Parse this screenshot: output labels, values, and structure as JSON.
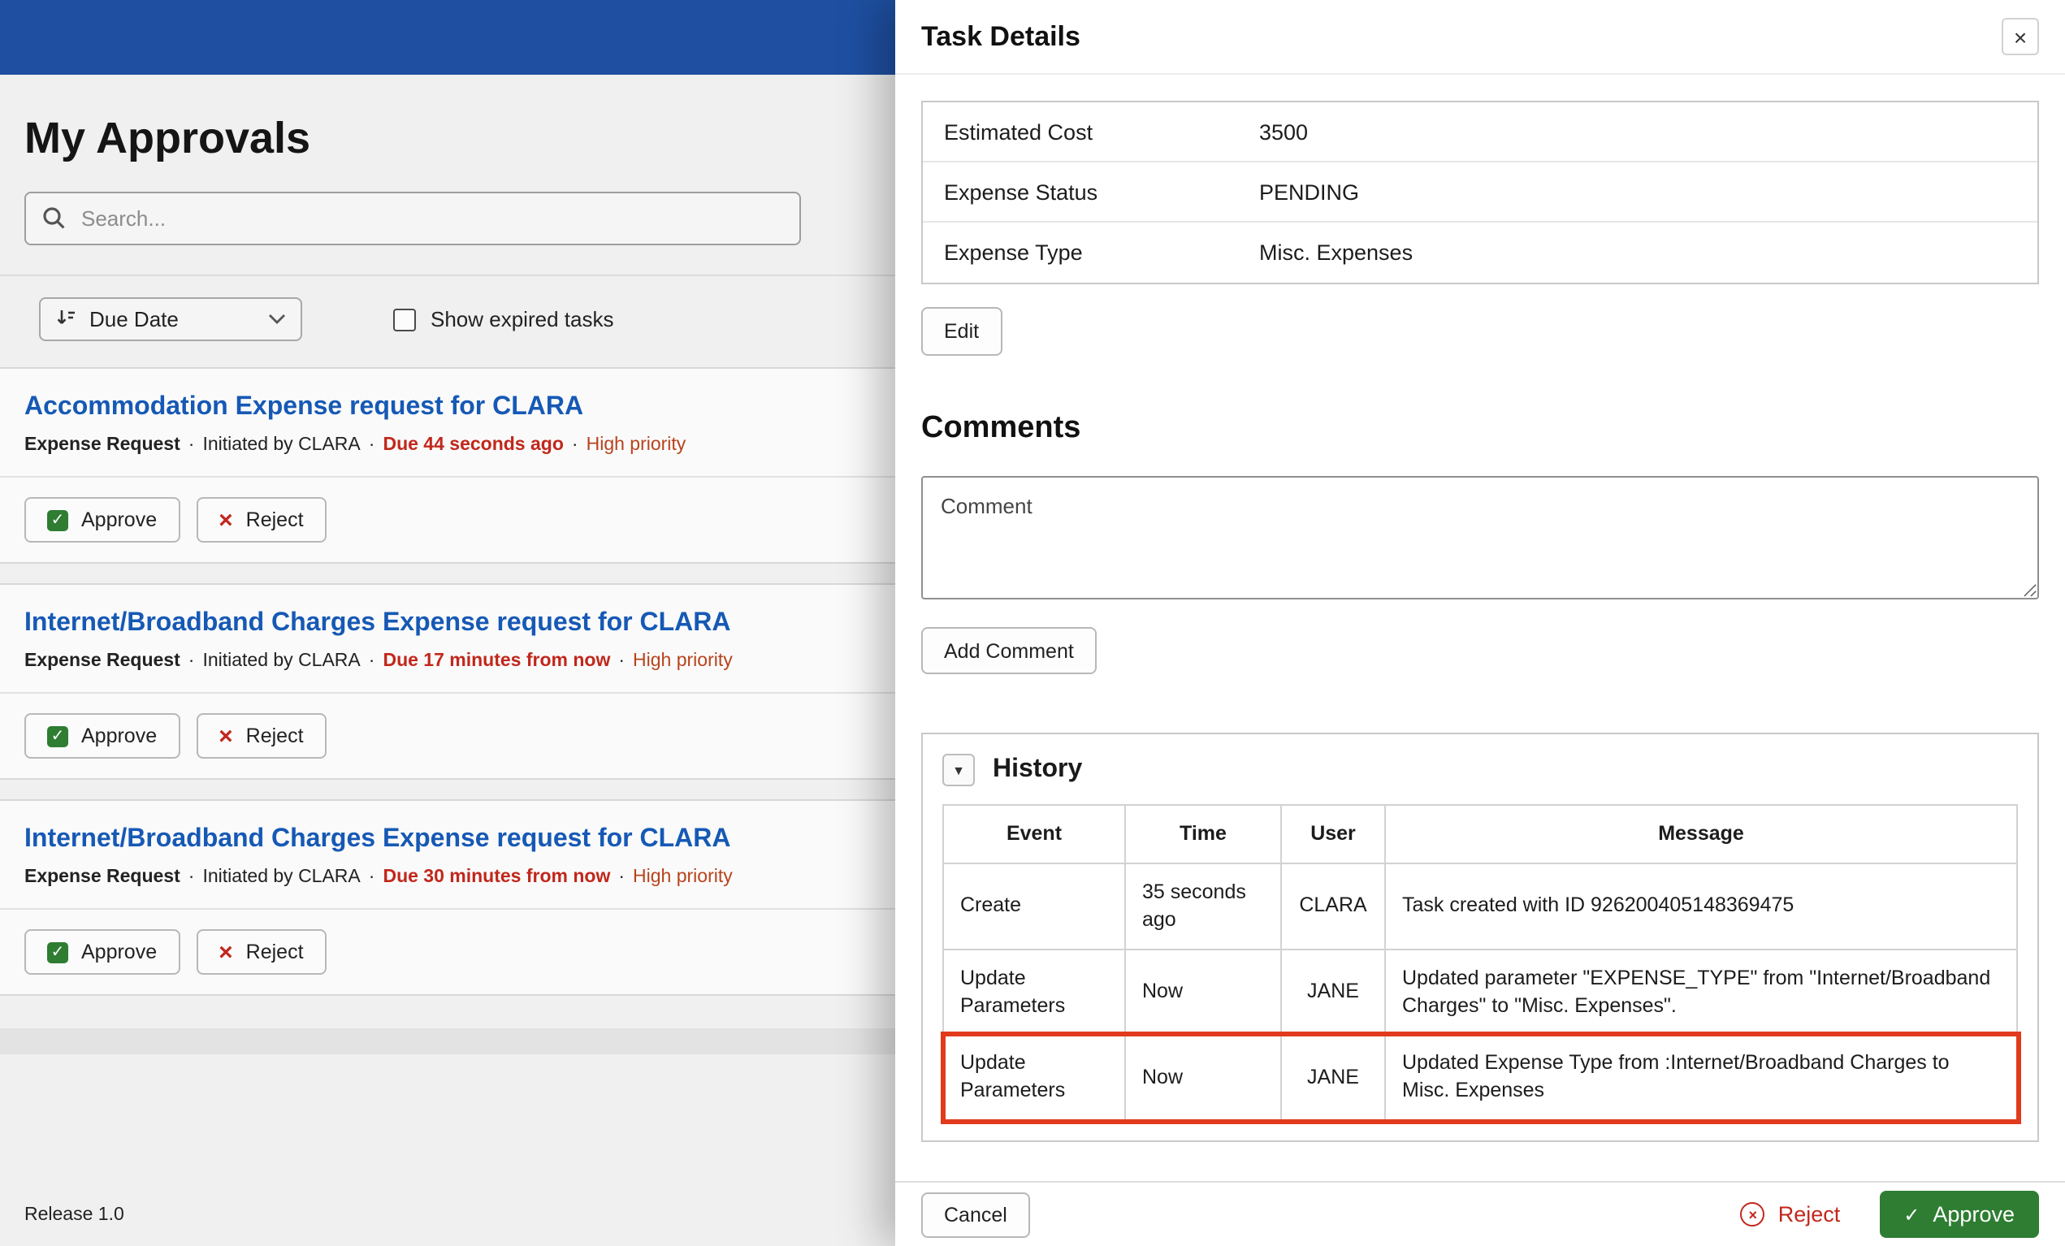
{
  "ui": {
    "dot": "·"
  },
  "icons": {
    "close": "×",
    "check": "✓",
    "cross": "×",
    "collapse": "▼"
  },
  "colors": {
    "header_blue": "#1e4fa1",
    "link_blue": "#1659b5",
    "approve_green": "#2e7d32",
    "danger_red": "#c3271d",
    "highlight_red": "#e23a1d"
  },
  "page": {
    "title": "My Approvals",
    "release": "Release 1.0"
  },
  "search": {
    "placeholder": "Search..."
  },
  "toolbar": {
    "sort_label": "Due Date",
    "show_expired_label": "Show expired tasks"
  },
  "actions": {
    "approve": "Approve",
    "reject": "Reject"
  },
  "tasks": [
    {
      "title": "Accommodation Expense request for CLARA",
      "type": "Expense Request",
      "initiated": "Initiated by CLARA",
      "due": "Due 44 seconds ago",
      "priority": "High priority"
    },
    {
      "title": "Internet/Broadband Charges Expense request for CLARA",
      "type": "Expense Request",
      "initiated": "Initiated by CLARA",
      "due": "Due 17 minutes from now",
      "priority": "High priority"
    },
    {
      "title": "Internet/Broadband Charges Expense request for CLARA",
      "type": "Expense Request",
      "initiated": "Initiated by CLARA",
      "due": "Due 30 minutes from now",
      "priority": "High priority"
    }
  ],
  "drawer": {
    "title": "Task Details",
    "details": [
      {
        "label": "Estimated Cost",
        "value": "3500"
      },
      {
        "label": "Expense Status",
        "value": "PENDING"
      },
      {
        "label": "Expense Type",
        "value": "Misc. Expenses"
      }
    ],
    "edit_label": "Edit",
    "comments": {
      "heading": "Comments",
      "placeholder": "Comment",
      "add_label": "Add Comment"
    },
    "history": {
      "heading": "History",
      "columns": [
        "Event",
        "Time",
        "User",
        "Message"
      ],
      "rows": [
        {
          "event": "Create",
          "time": "35 seconds ago",
          "user": "CLARA",
          "message": "Task created with ID 926200405148369475"
        },
        {
          "event": "Update Parameters",
          "time": "Now",
          "user": "JANE",
          "message": "Updated parameter \"EXPENSE_TYPE\" from \"Internet/Broadband Charges\" to \"Misc. Expenses\"."
        },
        {
          "event": "Update Parameters",
          "time": "Now",
          "user": "JANE",
          "message": "Updated Expense Type from :Internet/Broadband Charges to Misc. Expenses"
        }
      ]
    },
    "footer": {
      "cancel": "Cancel",
      "reject": "Reject",
      "approve": "Approve"
    }
  }
}
